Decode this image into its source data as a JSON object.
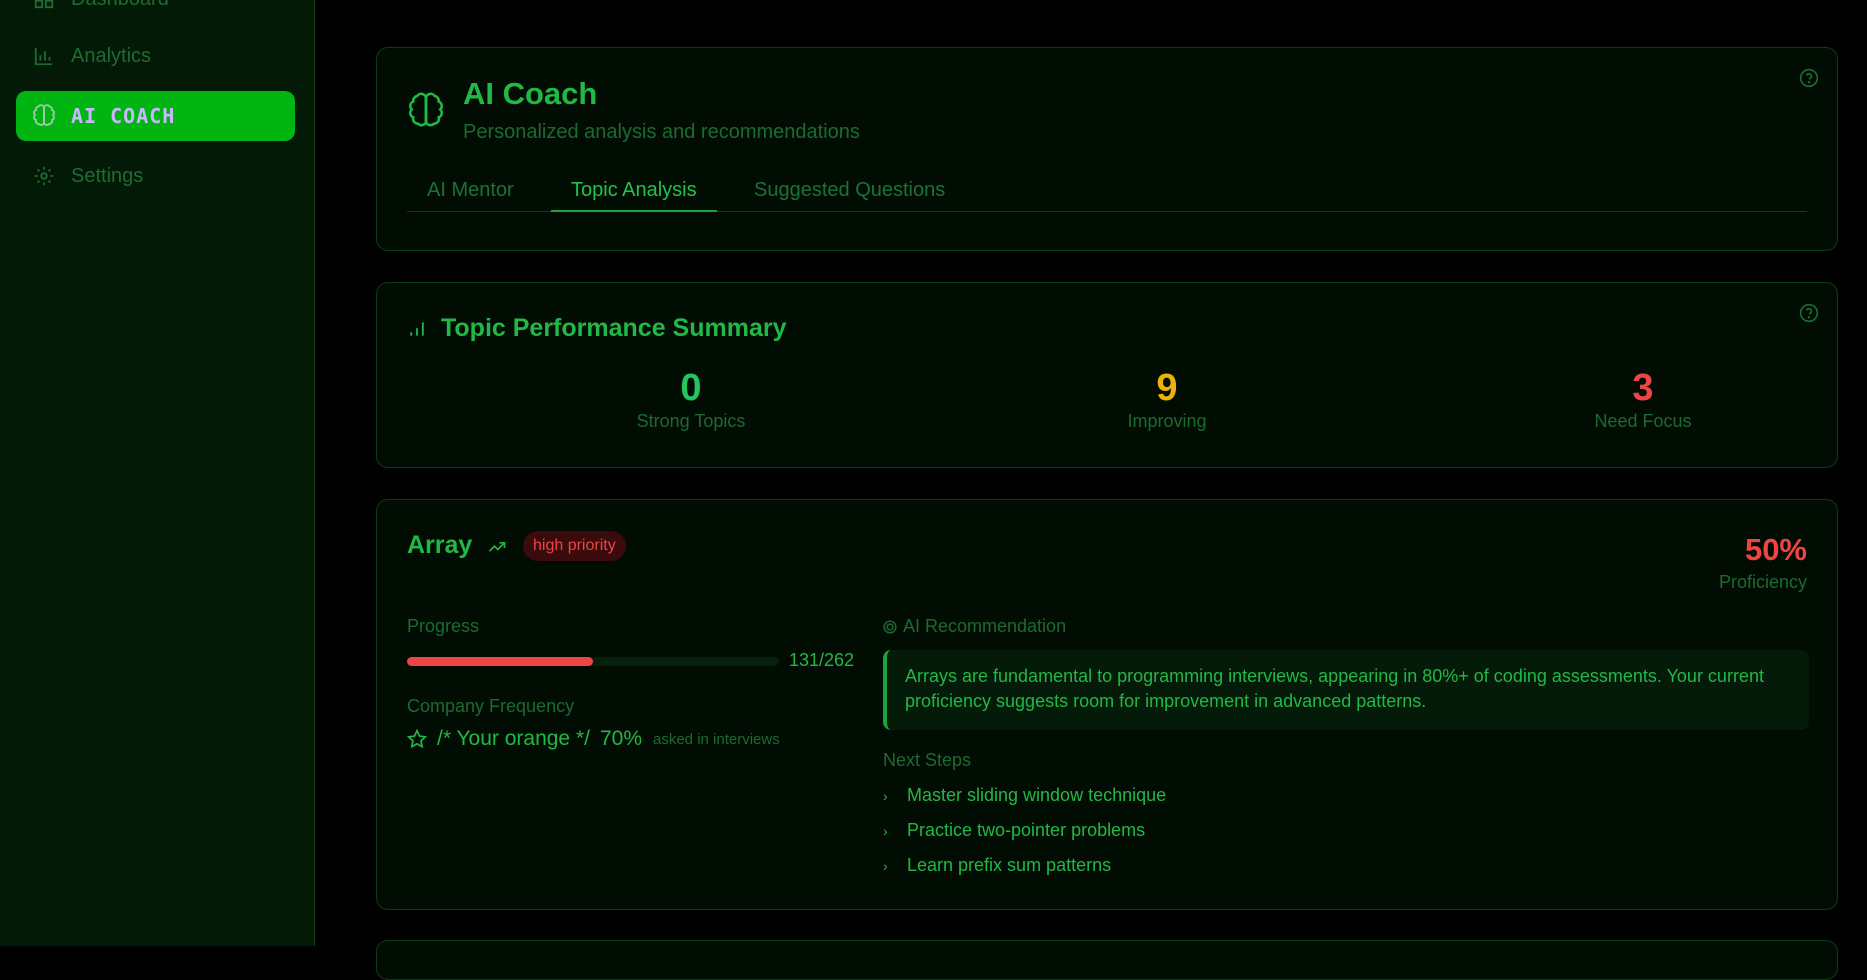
{
  "sidebar": {
    "items": [
      {
        "label": "Dashboard",
        "icon": "dashboard-icon"
      },
      {
        "label": "Analytics",
        "icon": "bar-chart-icon"
      },
      {
        "label": "AI COACH",
        "icon": "brain-icon",
        "active": true
      },
      {
        "label": "Settings",
        "icon": "gear-icon"
      }
    ]
  },
  "coach": {
    "title": "AI Coach",
    "subtitle": "Personalized analysis and recommendations",
    "tabs": [
      {
        "label": "AI Mentor"
      },
      {
        "label": "Topic Analysis",
        "active": true
      },
      {
        "label": "Suggested Questions"
      }
    ]
  },
  "summary": {
    "title": "Topic Performance Summary",
    "stats": [
      {
        "value": "0",
        "label": "Strong Topics",
        "color": "#22c55e"
      },
      {
        "value": "9",
        "label": "Improving",
        "color": "#eab308"
      },
      {
        "value": "3",
        "label": "Need Focus",
        "color": "#ef4444"
      }
    ]
  },
  "topic": {
    "name": "Array",
    "priority": "high priority",
    "proficiency": "50%",
    "proficiency_label": "Proficiency",
    "progress_label": "Progress",
    "progress_fraction": 0.5,
    "progress_count": "131/262",
    "frequency_label": "Company Frequency",
    "frequency_text": "/* Your orange */",
    "frequency_pct": "70%",
    "frequency_note": "asked in interviews",
    "rec_label": "AI Recommendation",
    "rec_text": "Arrays are fundamental to programming interviews, appearing in 80%+ of coding assessments. Your current proficiency suggests room for improvement in advanced patterns.",
    "next_steps_label": "Next Steps",
    "next_steps": [
      "Master sliding window technique",
      "Practice two-pointer problems",
      "Learn prefix sum patterns"
    ]
  },
  "colors": {
    "accent": "#22b845",
    "active_nav": "#00b512",
    "danger": "#ef4444",
    "warning": "#eab308"
  }
}
